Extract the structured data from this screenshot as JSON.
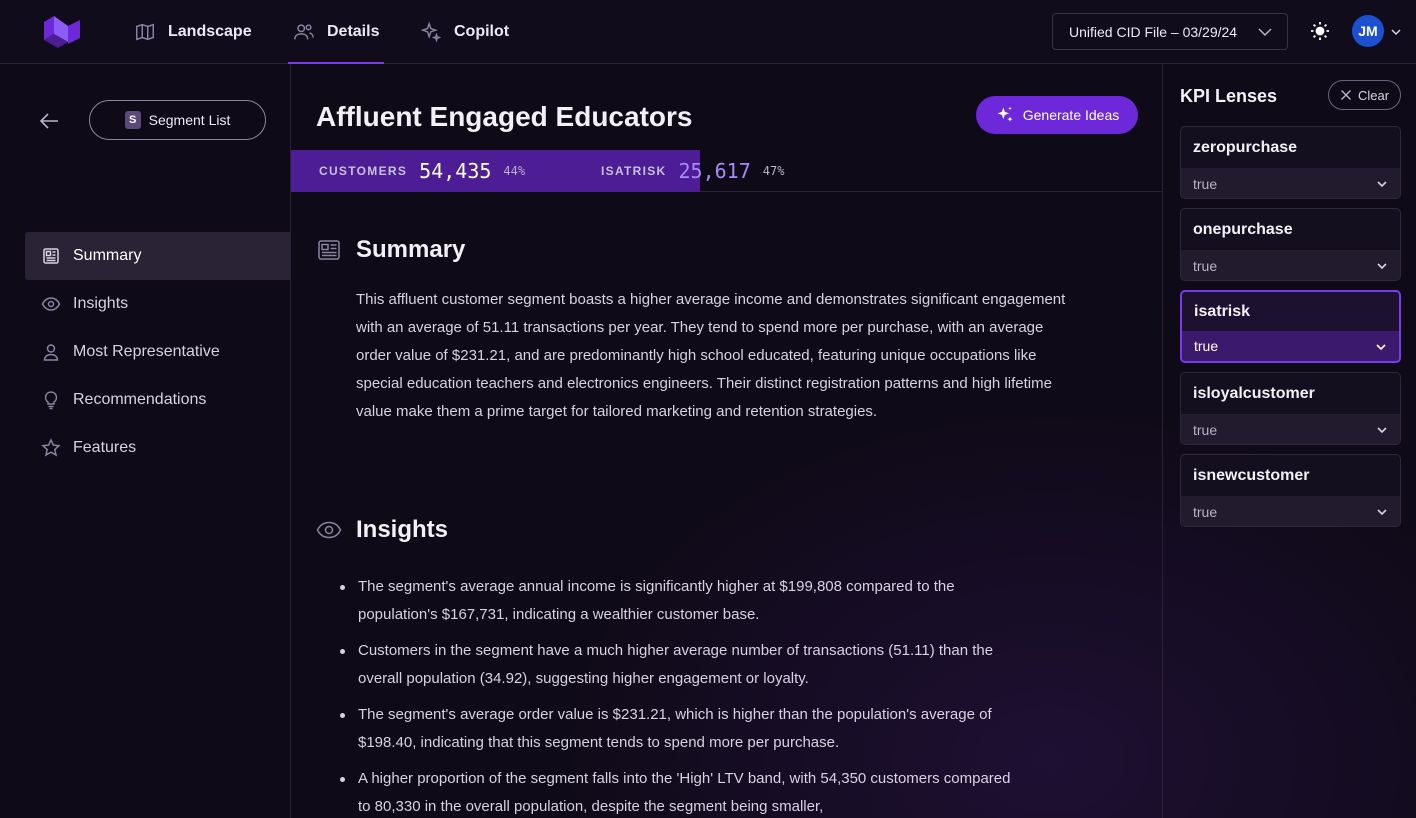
{
  "nav": {
    "items": [
      {
        "label": "Landscape",
        "icon": "map-icon"
      },
      {
        "label": "Details",
        "icon": "users-icon",
        "active": true
      },
      {
        "label": "Copilot",
        "icon": "sparkles-icon"
      }
    ],
    "file_select": "Unified CID File – 03/29/24",
    "avatar_initials": "JM"
  },
  "sidebar": {
    "segment_list_label": "Segment List",
    "segment_badge": "S",
    "items": [
      {
        "label": "Summary",
        "icon": "newspaper-icon",
        "active": true
      },
      {
        "label": "Insights",
        "icon": "eye-icon"
      },
      {
        "label": "Most Representative",
        "icon": "user-icon"
      },
      {
        "label": "Recommendations",
        "icon": "lightbulb-icon"
      },
      {
        "label": "Features",
        "icon": "star-icon"
      }
    ]
  },
  "main": {
    "title": "Affluent Engaged Educators",
    "generate_label": "Generate Ideas",
    "metrics": {
      "customers_label": "CUSTOMERS",
      "customers_value": "54,435",
      "customers_pct": "44%",
      "isatrisk_label": "ISATRISK",
      "isatrisk_value": "25,617",
      "isatrisk_pct": "47%"
    },
    "summary_heading": "Summary",
    "summary_text": "This affluent customer segment boasts a higher average income and demonstrates significant engagement with an average of 51.11 transactions per year. They tend to spend more per purchase, with an average order value of $231.21, and are predominantly high school educated, featuring unique occupations like special education teachers and electronics engineers. Their distinct registration patterns and high lifetime value make them a prime target for tailored marketing and retention strategies.",
    "insights_heading": "Insights",
    "insights": [
      "The segment's average annual income is significantly higher at $199,808 compared to the population's $167,731, indicating a wealthier customer base.",
      "Customers in the segment have a much higher average number of transactions (51.11) than the overall population (34.92), suggesting higher engagement or loyalty.",
      "The segment's average order value is $231.21, which is higher than the population's average of $198.40, indicating that this segment tends to spend more per purchase.",
      "A higher proportion of the segment falls into the 'High' LTV band, with 54,350 customers compared to 80,330 in the overall population, despite the segment being smaller,"
    ]
  },
  "kpi": {
    "title": "KPI Lenses",
    "clear_label": "Clear",
    "lenses": [
      {
        "name": "zeropurchase",
        "value": "true"
      },
      {
        "name": "onepurchase",
        "value": "true"
      },
      {
        "name": "isatrisk",
        "value": "true",
        "active": true
      },
      {
        "name": "isloyalcustomer",
        "value": "true"
      },
      {
        "name": "isnewcustomer",
        "value": "true"
      }
    ]
  },
  "colors": {
    "accent": "#7c3aed",
    "background": "#0f0a18",
    "avatar": "#1d4fd1"
  }
}
